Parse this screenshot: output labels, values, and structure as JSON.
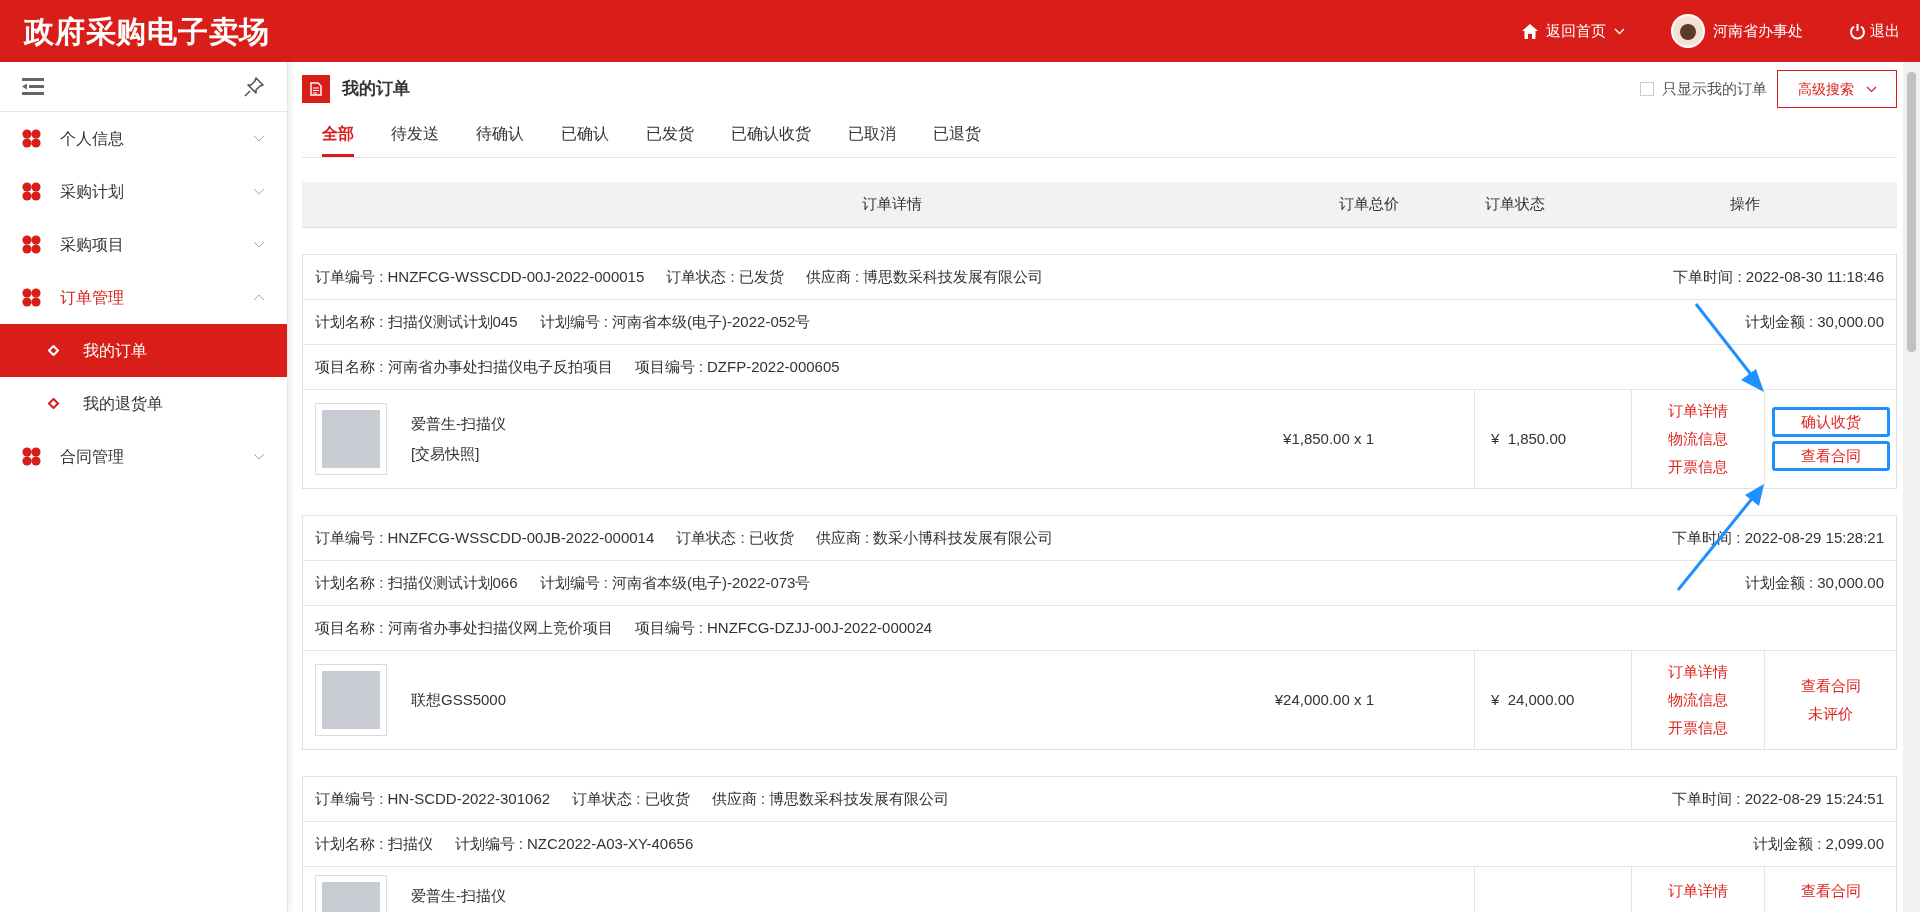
{
  "header": {
    "logo": "政府采购电子卖场",
    "home": "返回首页",
    "user": "河南省办事处",
    "logout": "退出"
  },
  "sidebar": {
    "items": [
      {
        "label": "个人信息",
        "expanded": false
      },
      {
        "label": "采购计划",
        "expanded": false
      },
      {
        "label": "采购项目",
        "expanded": false
      },
      {
        "label": "订单管理",
        "expanded": true,
        "children": [
          {
            "label": "我的订单",
            "selected": true
          },
          {
            "label": "我的退货单",
            "selected": false
          }
        ]
      },
      {
        "label": "合同管理",
        "expanded": false
      }
    ]
  },
  "page": {
    "title": "我的订单",
    "only_mine": {
      "label": "只显示我的订单",
      "checked": false
    },
    "advanced_search": "高级搜索",
    "tabs": [
      {
        "label": "全部",
        "selected": true
      },
      {
        "label": "待发送",
        "selected": false
      },
      {
        "label": "待确认",
        "selected": false
      },
      {
        "label": "已确认",
        "selected": false
      },
      {
        "label": "已发货",
        "selected": false
      },
      {
        "label": "已确认收货",
        "selected": false
      },
      {
        "label": "已取消",
        "selected": false
      },
      {
        "label": "已退货",
        "selected": false
      }
    ],
    "table": {
      "columns": [
        "订单详情",
        "订单总价",
        "订单状态",
        "操作"
      ]
    },
    "orders": [
      {
        "order_no": "订单编号 : HNZFCG-WSSCDD-00J-2022-000015",
        "status": "订单状态 : 已发货",
        "supplier": "供应商 : 博思数采科技发展有限公司",
        "time": "下单时间 : 2022-08-30 11:18:46",
        "plan_name": "计划名称 : 扫描仪测试计划045",
        "plan_no": "计划编号 : 河南省本级(电子)-2022-052号",
        "plan_amount": "计划金额 : 30,000.00",
        "project_name": "项目名称 : 河南省办事处扫描仪电子反拍项目",
        "project_no": "项目编号 : DZFP-2022-000605",
        "item": {
          "name": "爱普生-扫描仪",
          "snapshot": "[交易快照]",
          "unit_price": "¥1,850.00 x 1",
          "total": "¥  1,850.00"
        },
        "status_links": [
          "订单详情",
          "物流信息",
          "开票信息"
        ],
        "actions": [
          {
            "label": "确认收货",
            "highlighted": true
          },
          {
            "label": "查看合同",
            "highlighted": true
          }
        ]
      },
      {
        "order_no": "订单编号 : HNZFCG-WSSCDD-00JB-2022-000014",
        "status": "订单状态 : 已收货",
        "supplier": "供应商 : 数采小博科技发展有限公司",
        "time": "下单时间 : 2022-08-29 15:28:21",
        "plan_name": "计划名称 : 扫描仪测试计划066",
        "plan_no": "计划编号 : 河南省本级(电子)-2022-073号",
        "plan_amount": "计划金额 : 30,000.00",
        "project_name": "项目名称 : 河南省办事处扫描仪网上竞价项目",
        "project_no": "项目编号 : HNZFCG-DZJJ-00J-2022-000024",
        "item": {
          "name": "联想GSS5000",
          "unit_price": "¥24,000.00 x 1",
          "total": "¥  24,000.00"
        },
        "status_links": [
          "订单详情",
          "物流信息",
          "开票信息"
        ],
        "actions": [
          {
            "label": "查看合同",
            "highlighted": false
          },
          {
            "label": "未评价",
            "highlighted": false
          }
        ]
      },
      {
        "order_no": "订单编号 : HN-SCDD-2022-301062",
        "status": "订单状态 : 已收货",
        "supplier": "供应商 : 博思数采科技发展有限公司",
        "time": "下单时间 : 2022-08-29 15:24:51",
        "plan_name": "计划名称 : 扫描仪",
        "plan_no": "计划编号 : NZC2022-A03-XY-40656",
        "plan_amount": "计划金额 : 2,099.00",
        "item": {
          "name": "爱普生-扫描仪"
        },
        "status_links": [
          "订单详情"
        ],
        "actions": [
          {
            "label": "查看合同",
            "highlighted": false
          }
        ]
      }
    ]
  }
}
